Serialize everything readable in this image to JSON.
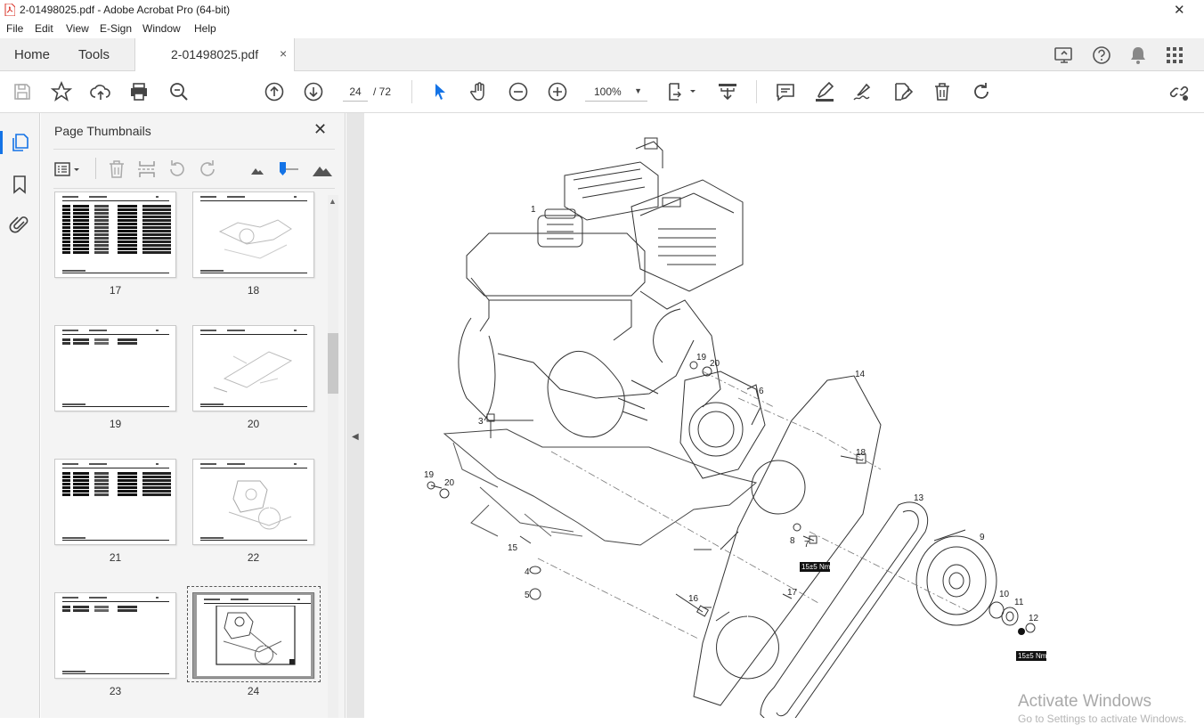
{
  "window": {
    "title": "2-01498025.pdf - Adobe Acrobat Pro (64-bit)",
    "close_glyph": "✕"
  },
  "menu": [
    "File",
    "Edit",
    "View",
    "E-Sign",
    "Window",
    "Help"
  ],
  "tabs": {
    "home": "Home",
    "tools": "Tools",
    "document": "2-01498025.pdf",
    "close_glyph": "×"
  },
  "toolbar": {
    "icons": [
      "save-icon",
      "bookmark-star-icon",
      "upload-icon",
      "print-icon",
      "search-zoom-icon",
      "page-up-icon",
      "page-down-icon",
      "select-cursor-icon",
      "hand-icon",
      "zoom-out-icon",
      "zoom-in-icon",
      "page-fit-icon",
      "scroll-mode-icon",
      "comment-icon",
      "highlight-icon",
      "sign-icon",
      "edit-icon",
      "delete-icon",
      "redo-icon",
      "share-link-icon"
    ],
    "current_page": "24",
    "page_total": "/ 72",
    "zoom": "100%",
    "accent": "#1473e6"
  },
  "top_right_icons": [
    "share-screen-icon",
    "help-icon",
    "bell-icon",
    "apps-grid-icon"
  ],
  "thumbnails_panel": {
    "title": "Page Thumbnails",
    "close_glyph": "✕",
    "pages": [
      {
        "label": "17",
        "kind": "table"
      },
      {
        "label": "18",
        "kind": "drawing"
      },
      {
        "label": "19",
        "kind": "sparse"
      },
      {
        "label": "20",
        "kind": "drawing"
      },
      {
        "label": "21",
        "kind": "table"
      },
      {
        "label": "22",
        "kind": "drawing"
      },
      {
        "label": "23",
        "kind": "sparse"
      },
      {
        "label": "24",
        "kind": "drawing",
        "selected": true
      }
    ]
  },
  "drawing": {
    "callouts": [
      "1",
      "3",
      "4",
      "5",
      "6",
      "7",
      "8",
      "9",
      "10",
      "11",
      "12",
      "13",
      "14",
      "15",
      "16",
      "17",
      "18",
      "19",
      "20",
      "19",
      "20"
    ],
    "torque_labels": [
      "15±5 Nm",
      "15±5 Nm"
    ]
  },
  "watermark": {
    "line1": "Activate Windows",
    "line2": "Go to Settings to activate Windows."
  }
}
